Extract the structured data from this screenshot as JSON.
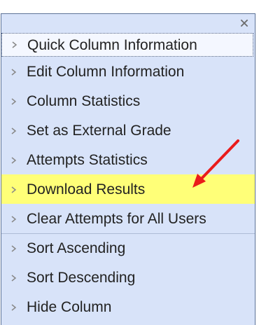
{
  "menu": {
    "close_icon": "close-icon",
    "items": [
      {
        "label": "Quick Column Information",
        "icon": "chevron-right-icon",
        "state": "focused"
      },
      {
        "label": "Edit Column Information",
        "icon": "chevron-right-icon"
      },
      {
        "label": "Column Statistics",
        "icon": "chevron-right-icon"
      },
      {
        "label": "Set as External Grade",
        "icon": "chevron-right-icon"
      },
      {
        "label": "Attempts Statistics",
        "icon": "chevron-right-icon"
      },
      {
        "label": "Download Results",
        "icon": "chevron-right-icon",
        "state": "highlighted"
      },
      {
        "label": "Clear Attempts for All Users",
        "icon": "chevron-right-icon"
      },
      {
        "label": "Sort Ascending",
        "icon": "chevron-right-icon"
      },
      {
        "label": "Sort Descending",
        "icon": "chevron-right-icon"
      },
      {
        "label": "Hide Column",
        "icon": "chevron-right-icon"
      }
    ]
  },
  "annotation": {
    "icon": "red-arrow-icon",
    "color": "#ea1b1b"
  },
  "colors": {
    "menu_background": "#d8e3f9",
    "highlight": "#ffff78",
    "border": "#5d7398"
  }
}
